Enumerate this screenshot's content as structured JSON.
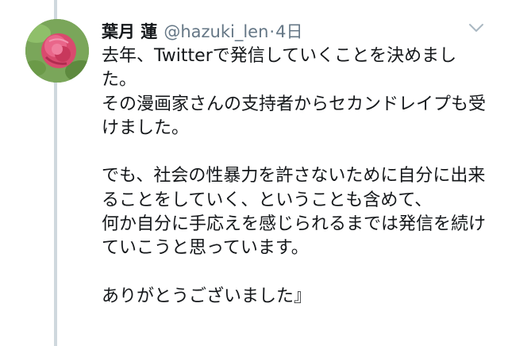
{
  "tweet": {
    "display_name": "葉月 蓮",
    "handle": "@hazuki_len",
    "separator": "·",
    "timestamp": "4日",
    "text": "去年、Twitterで発信していくことを決めました。\nその漫画家さんの支持者からセカンドレイプも受けました。\n\nでも、社会の性暴力を許さないために自分に出来ることをしていく、ということも含めて、\n何か自分に手応えを感じられるまでは発信を続けていこうと思っています。\n\nありがとうございました』"
  },
  "icons": {
    "avatar": "rose-flower-avatar",
    "menu": "chevron-down-icon"
  },
  "colors": {
    "text": "#14171a",
    "secondary": "#657786",
    "thread_line": "#cfd8de",
    "background": "#ffffff"
  }
}
